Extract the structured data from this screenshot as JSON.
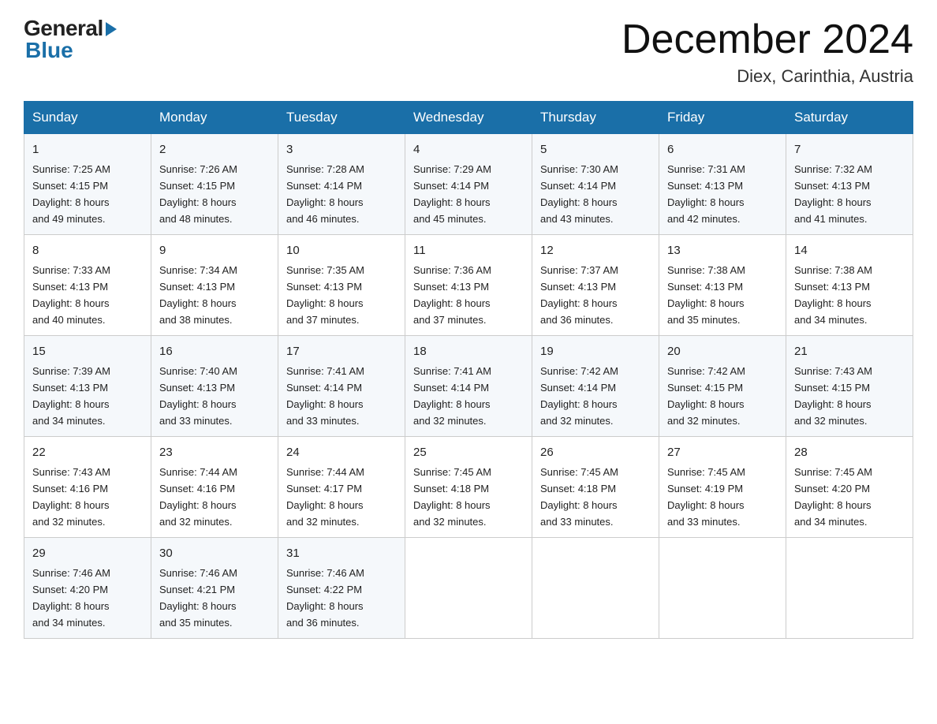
{
  "logo": {
    "general": "General",
    "blue": "Blue"
  },
  "title": "December 2024",
  "location": "Diex, Carinthia, Austria",
  "days_of_week": [
    "Sunday",
    "Monday",
    "Tuesday",
    "Wednesday",
    "Thursday",
    "Friday",
    "Saturday"
  ],
  "weeks": [
    [
      {
        "day": "1",
        "sunrise": "7:25 AM",
        "sunset": "4:15 PM",
        "daylight": "8 hours and 49 minutes."
      },
      {
        "day": "2",
        "sunrise": "7:26 AM",
        "sunset": "4:15 PM",
        "daylight": "8 hours and 48 minutes."
      },
      {
        "day": "3",
        "sunrise": "7:28 AM",
        "sunset": "4:14 PM",
        "daylight": "8 hours and 46 minutes."
      },
      {
        "day": "4",
        "sunrise": "7:29 AM",
        "sunset": "4:14 PM",
        "daylight": "8 hours and 45 minutes."
      },
      {
        "day": "5",
        "sunrise": "7:30 AM",
        "sunset": "4:14 PM",
        "daylight": "8 hours and 43 minutes."
      },
      {
        "day": "6",
        "sunrise": "7:31 AM",
        "sunset": "4:13 PM",
        "daylight": "8 hours and 42 minutes."
      },
      {
        "day": "7",
        "sunrise": "7:32 AM",
        "sunset": "4:13 PM",
        "daylight": "8 hours and 41 minutes."
      }
    ],
    [
      {
        "day": "8",
        "sunrise": "7:33 AM",
        "sunset": "4:13 PM",
        "daylight": "8 hours and 40 minutes."
      },
      {
        "day": "9",
        "sunrise": "7:34 AM",
        "sunset": "4:13 PM",
        "daylight": "8 hours and 38 minutes."
      },
      {
        "day": "10",
        "sunrise": "7:35 AM",
        "sunset": "4:13 PM",
        "daylight": "8 hours and 37 minutes."
      },
      {
        "day": "11",
        "sunrise": "7:36 AM",
        "sunset": "4:13 PM",
        "daylight": "8 hours and 37 minutes."
      },
      {
        "day": "12",
        "sunrise": "7:37 AM",
        "sunset": "4:13 PM",
        "daylight": "8 hours and 36 minutes."
      },
      {
        "day": "13",
        "sunrise": "7:38 AM",
        "sunset": "4:13 PM",
        "daylight": "8 hours and 35 minutes."
      },
      {
        "day": "14",
        "sunrise": "7:38 AM",
        "sunset": "4:13 PM",
        "daylight": "8 hours and 34 minutes."
      }
    ],
    [
      {
        "day": "15",
        "sunrise": "7:39 AM",
        "sunset": "4:13 PM",
        "daylight": "8 hours and 34 minutes."
      },
      {
        "day": "16",
        "sunrise": "7:40 AM",
        "sunset": "4:13 PM",
        "daylight": "8 hours and 33 minutes."
      },
      {
        "day": "17",
        "sunrise": "7:41 AM",
        "sunset": "4:14 PM",
        "daylight": "8 hours and 33 minutes."
      },
      {
        "day": "18",
        "sunrise": "7:41 AM",
        "sunset": "4:14 PM",
        "daylight": "8 hours and 32 minutes."
      },
      {
        "day": "19",
        "sunrise": "7:42 AM",
        "sunset": "4:14 PM",
        "daylight": "8 hours and 32 minutes."
      },
      {
        "day": "20",
        "sunrise": "7:42 AM",
        "sunset": "4:15 PM",
        "daylight": "8 hours and 32 minutes."
      },
      {
        "day": "21",
        "sunrise": "7:43 AM",
        "sunset": "4:15 PM",
        "daylight": "8 hours and 32 minutes."
      }
    ],
    [
      {
        "day": "22",
        "sunrise": "7:43 AM",
        "sunset": "4:16 PM",
        "daylight": "8 hours and 32 minutes."
      },
      {
        "day": "23",
        "sunrise": "7:44 AM",
        "sunset": "4:16 PM",
        "daylight": "8 hours and 32 minutes."
      },
      {
        "day": "24",
        "sunrise": "7:44 AM",
        "sunset": "4:17 PM",
        "daylight": "8 hours and 32 minutes."
      },
      {
        "day": "25",
        "sunrise": "7:45 AM",
        "sunset": "4:18 PM",
        "daylight": "8 hours and 32 minutes."
      },
      {
        "day": "26",
        "sunrise": "7:45 AM",
        "sunset": "4:18 PM",
        "daylight": "8 hours and 33 minutes."
      },
      {
        "day": "27",
        "sunrise": "7:45 AM",
        "sunset": "4:19 PM",
        "daylight": "8 hours and 33 minutes."
      },
      {
        "day": "28",
        "sunrise": "7:45 AM",
        "sunset": "4:20 PM",
        "daylight": "8 hours and 34 minutes."
      }
    ],
    [
      {
        "day": "29",
        "sunrise": "7:46 AM",
        "sunset": "4:20 PM",
        "daylight": "8 hours and 34 minutes."
      },
      {
        "day": "30",
        "sunrise": "7:46 AM",
        "sunset": "4:21 PM",
        "daylight": "8 hours and 35 minutes."
      },
      {
        "day": "31",
        "sunrise": "7:46 AM",
        "sunset": "4:22 PM",
        "daylight": "8 hours and 36 minutes."
      },
      null,
      null,
      null,
      null
    ]
  ],
  "labels": {
    "sunrise": "Sunrise:",
    "sunset": "Sunset:",
    "daylight": "Daylight:"
  }
}
